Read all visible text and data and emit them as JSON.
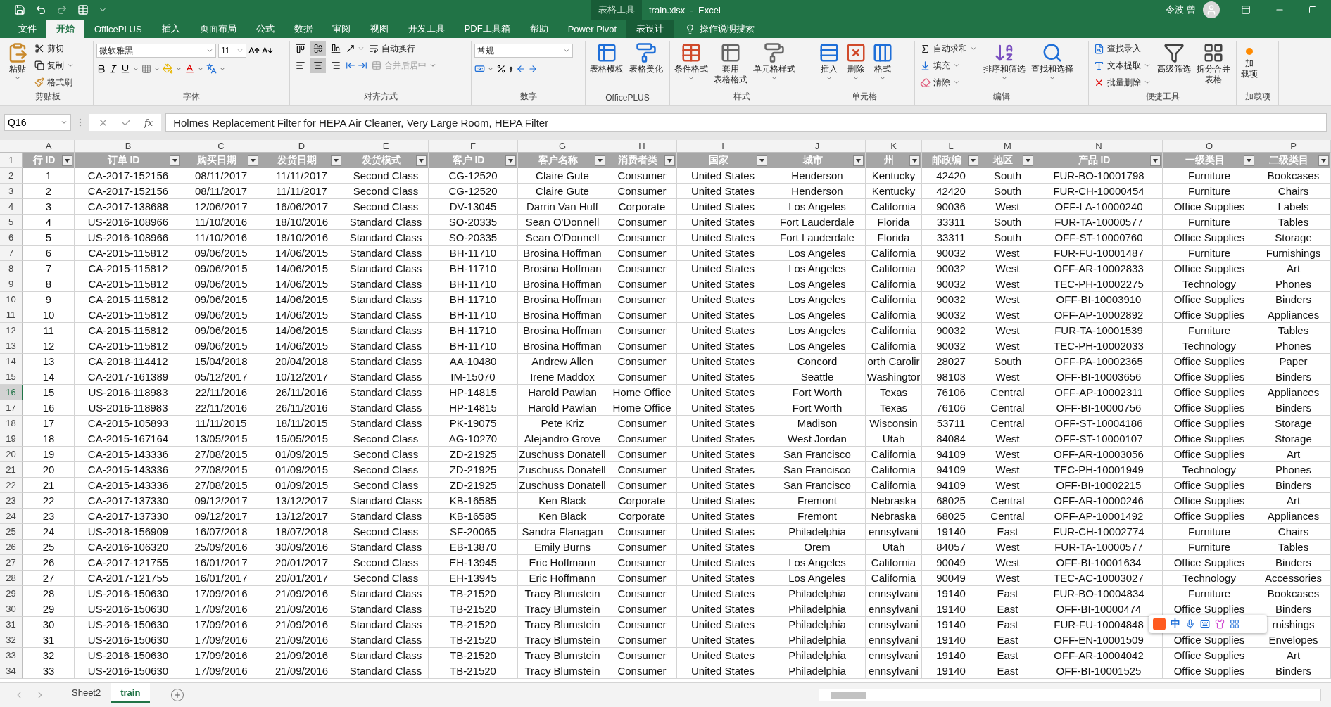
{
  "title_bar": {
    "context_label": "表格工具",
    "title": "train.xlsx  -  Excel",
    "user": "令波 曾"
  },
  "tabs": [
    {
      "label": "文件",
      "selected": false,
      "kind": "normal"
    },
    {
      "label": "开始",
      "selected": true,
      "kind": "normal"
    },
    {
      "label": "OfficePLUS",
      "selected": false,
      "kind": "normal"
    },
    {
      "label": "插入",
      "selected": false,
      "kind": "normal"
    },
    {
      "label": "页面布局",
      "selected": false,
      "kind": "normal"
    },
    {
      "label": "公式",
      "selected": false,
      "kind": "normal"
    },
    {
      "label": "数据",
      "selected": false,
      "kind": "normal"
    },
    {
      "label": "审阅",
      "selected": false,
      "kind": "normal"
    },
    {
      "label": "视图",
      "selected": false,
      "kind": "normal"
    },
    {
      "label": "开发工具",
      "selected": false,
      "kind": "normal"
    },
    {
      "label": "PDF工具箱",
      "selected": false,
      "kind": "normal"
    },
    {
      "label": "帮助",
      "selected": false,
      "kind": "normal"
    },
    {
      "label": "Power Pivot",
      "selected": false,
      "kind": "normal"
    },
    {
      "label": "表设计",
      "selected": false,
      "kind": "context"
    }
  ],
  "tell_me": "操作说明搜索",
  "ribbon": {
    "clipboard": {
      "label": "剪贴板",
      "paste": "粘贴",
      "cut": "剪切",
      "copy": "复制",
      "format_painter": "格式刷"
    },
    "font": {
      "label": "字体",
      "font_name": "微软雅黑",
      "font_size": "11"
    },
    "alignment": {
      "label": "对齐方式",
      "valign": [
        {
          "selected": false
        },
        {
          "selected": true
        },
        {
          "selected": false
        }
      ],
      "halign": [
        {
          "selected": false
        },
        {
          "selected": true
        },
        {
          "selected": false
        }
      ],
      "wrap_text": "自动换行",
      "merge_center": {
        "label": "合并后居中",
        "disabled": true
      }
    },
    "number": {
      "label": "数字",
      "format": "常规"
    },
    "officeplus": {
      "label": "OfficePLUS",
      "table_template": "表格模板",
      "table_beautify": "表格美化"
    },
    "styles": {
      "label": "样式",
      "conditional": "条件格式",
      "format_as_table": [
        "套用",
        "表格格式"
      ],
      "cell_styles": "单元格样式"
    },
    "cells": {
      "label": "单元格",
      "insert": "插入",
      "delete": "删除",
      "format": "格式"
    },
    "editing": {
      "label": "编辑",
      "autosum": "自动求和",
      "fill": "填充",
      "clear": "清除",
      "sort_filter": "排序和筛选",
      "find_select": "查找和选择"
    },
    "tools": {
      "label": "便捷工具",
      "find_entry": "查找录入",
      "text_extract": "文本提取",
      "batch_delete": "批量删除",
      "advanced_filter": "高级筛选",
      "split_merge": [
        "拆分合并",
        "表格"
      ]
    },
    "addins": {
      "label": "加载项",
      "button": [
        "加",
        "载项"
      ]
    }
  },
  "formula_bar": {
    "name_box": "Q16",
    "fx": "fx",
    "content": "Holmes Replacement Filter for HEPA Air Cleaner, Very Large Room, HEPA Filter"
  },
  "column_letters": [
    "A",
    "B",
    "C",
    "D",
    "E",
    "F",
    "G",
    "H",
    "I",
    "J",
    "K",
    "L",
    "M",
    "N",
    "O",
    "P"
  ],
  "header_row": {
    "row": "1",
    "cells": [
      "行 ID",
      "订单 ID",
      "购买日期",
      "发货日期",
      "发货模式",
      "客户 ID",
      "客户名称",
      "消费者类",
      "国家",
      "城市",
      "州",
      "邮政编",
      "地区",
      "产品 ID",
      "一级类目",
      "二级类目"
    ]
  },
  "rows": [
    {
      "row": "2",
      "selected": false,
      "cells": [
        "1",
        "CA-2017-152156",
        "08/11/2017",
        "11/11/2017",
        "Second Class",
        "CG-12520",
        "Claire Gute",
        "Consumer",
        "United States",
        "Henderson",
        "Kentucky",
        "42420",
        "South",
        "FUR-BO-10001798",
        "Furniture",
        "Bookcases"
      ]
    },
    {
      "row": "3",
      "selected": false,
      "cells": [
        "2",
        "CA-2017-152156",
        "08/11/2017",
        "11/11/2017",
        "Second Class",
        "CG-12520",
        "Claire Gute",
        "Consumer",
        "United States",
        "Henderson",
        "Kentucky",
        "42420",
        "South",
        "FUR-CH-10000454",
        "Furniture",
        "Chairs"
      ]
    },
    {
      "row": "4",
      "selected": false,
      "cells": [
        "3",
        "CA-2017-138688",
        "12/06/2017",
        "16/06/2017",
        "Second Class",
        "DV-13045",
        "Darrin Van Huff",
        "Corporate",
        "United States",
        "Los Angeles",
        "California",
        "90036",
        "West",
        "OFF-LA-10000240",
        "Office Supplies",
        "Labels"
      ]
    },
    {
      "row": "5",
      "selected": false,
      "cells": [
        "4",
        "US-2016-108966",
        "11/10/2016",
        "18/10/2016",
        "Standard Class",
        "SO-20335",
        "Sean O'Donnell",
        "Consumer",
        "United States",
        "Fort Lauderdale",
        "Florida",
        "33311",
        "South",
        "FUR-TA-10000577",
        "Furniture",
        "Tables"
      ]
    },
    {
      "row": "6",
      "selected": false,
      "cells": [
        "5",
        "US-2016-108966",
        "11/10/2016",
        "18/10/2016",
        "Standard Class",
        "SO-20335",
        "Sean O'Donnell",
        "Consumer",
        "United States",
        "Fort Lauderdale",
        "Florida",
        "33311",
        "South",
        "OFF-ST-10000760",
        "Office Supplies",
        "Storage"
      ]
    },
    {
      "row": "7",
      "selected": false,
      "cells": [
        "6",
        "CA-2015-115812",
        "09/06/2015",
        "14/06/2015",
        "Standard Class",
        "BH-11710",
        "Brosina Hoffman",
        "Consumer",
        "United States",
        "Los Angeles",
        "California",
        "90032",
        "West",
        "FUR-FU-10001487",
        "Furniture",
        "Furnishings"
      ]
    },
    {
      "row": "8",
      "selected": false,
      "cells": [
        "7",
        "CA-2015-115812",
        "09/06/2015",
        "14/06/2015",
        "Standard Class",
        "BH-11710",
        "Brosina Hoffman",
        "Consumer",
        "United States",
        "Los Angeles",
        "California",
        "90032",
        "West",
        "OFF-AR-10002833",
        "Office Supplies",
        "Art"
      ]
    },
    {
      "row": "9",
      "selected": false,
      "cells": [
        "8",
        "CA-2015-115812",
        "09/06/2015",
        "14/06/2015",
        "Standard Class",
        "BH-11710",
        "Brosina Hoffman",
        "Consumer",
        "United States",
        "Los Angeles",
        "California",
        "90032",
        "West",
        "TEC-PH-10002275",
        "Technology",
        "Phones"
      ]
    },
    {
      "row": "10",
      "selected": false,
      "cells": [
        "9",
        "CA-2015-115812",
        "09/06/2015",
        "14/06/2015",
        "Standard Class",
        "BH-11710",
        "Brosina Hoffman",
        "Consumer",
        "United States",
        "Los Angeles",
        "California",
        "90032",
        "West",
        "OFF-BI-10003910",
        "Office Supplies",
        "Binders"
      ]
    },
    {
      "row": "11",
      "selected": false,
      "cells": [
        "10",
        "CA-2015-115812",
        "09/06/2015",
        "14/06/2015",
        "Standard Class",
        "BH-11710",
        "Brosina Hoffman",
        "Consumer",
        "United States",
        "Los Angeles",
        "California",
        "90032",
        "West",
        "OFF-AP-10002892",
        "Office Supplies",
        "Appliances"
      ]
    },
    {
      "row": "12",
      "selected": false,
      "cells": [
        "11",
        "CA-2015-115812",
        "09/06/2015",
        "14/06/2015",
        "Standard Class",
        "BH-11710",
        "Brosina Hoffman",
        "Consumer",
        "United States",
        "Los Angeles",
        "California",
        "90032",
        "West",
        "FUR-TA-10001539",
        "Furniture",
        "Tables"
      ]
    },
    {
      "row": "13",
      "selected": false,
      "cells": [
        "12",
        "CA-2015-115812",
        "09/06/2015",
        "14/06/2015",
        "Standard Class",
        "BH-11710",
        "Brosina Hoffman",
        "Consumer",
        "United States",
        "Los Angeles",
        "California",
        "90032",
        "West",
        "TEC-PH-10002033",
        "Technology",
        "Phones"
      ]
    },
    {
      "row": "14",
      "selected": false,
      "cells": [
        "13",
        "CA-2018-114412",
        "15/04/2018",
        "20/04/2018",
        "Standard Class",
        "AA-10480",
        "Andrew Allen",
        "Consumer",
        "United States",
        "Concord",
        "orth Carolir",
        "28027",
        "South",
        "OFF-PA-10002365",
        "Office Supplies",
        "Paper"
      ]
    },
    {
      "row": "15",
      "selected": false,
      "cells": [
        "14",
        "CA-2017-161389",
        "05/12/2017",
        "10/12/2017",
        "Standard Class",
        "IM-15070",
        "Irene Maddox",
        "Consumer",
        "United States",
        "Seattle",
        "Washingtor",
        "98103",
        "West",
        "OFF-BI-10003656",
        "Office Supplies",
        "Binders"
      ]
    },
    {
      "row": "16",
      "selected": true,
      "cells": [
        "15",
        "US-2016-118983",
        "22/11/2016",
        "26/11/2016",
        "Standard Class",
        "HP-14815",
        "Harold Pawlan",
        "Home Office",
        "United States",
        "Fort Worth",
        "Texas",
        "76106",
        "Central",
        "OFF-AP-10002311",
        "Office Supplies",
        "Appliances"
      ]
    },
    {
      "row": "17",
      "selected": false,
      "cells": [
        "16",
        "US-2016-118983",
        "22/11/2016",
        "26/11/2016",
        "Standard Class",
        "HP-14815",
        "Harold Pawlan",
        "Home Office",
        "United States",
        "Fort Worth",
        "Texas",
        "76106",
        "Central",
        "OFF-BI-10000756",
        "Office Supplies",
        "Binders"
      ]
    },
    {
      "row": "18",
      "selected": false,
      "cells": [
        "17",
        "CA-2015-105893",
        "11/11/2015",
        "18/11/2015",
        "Standard Class",
        "PK-19075",
        "Pete Kriz",
        "Consumer",
        "United States",
        "Madison",
        "Wisconsin",
        "53711",
        "Central",
        "OFF-ST-10004186",
        "Office Supplies",
        "Storage"
      ]
    },
    {
      "row": "19",
      "selected": false,
      "cells": [
        "18",
        "CA-2015-167164",
        "13/05/2015",
        "15/05/2015",
        "Second Class",
        "AG-10270",
        "Alejandro Grove",
        "Consumer",
        "United States",
        "West Jordan",
        "Utah",
        "84084",
        "West",
        "OFF-ST-10000107",
        "Office Supplies",
        "Storage"
      ]
    },
    {
      "row": "20",
      "selected": false,
      "cells": [
        "19",
        "CA-2015-143336",
        "27/08/2015",
        "01/09/2015",
        "Second Class",
        "ZD-21925",
        "Zuschuss Donatell",
        "Consumer",
        "United States",
        "San Francisco",
        "California",
        "94109",
        "West",
        "OFF-AR-10003056",
        "Office Supplies",
        "Art"
      ]
    },
    {
      "row": "21",
      "selected": false,
      "cells": [
        "20",
        "CA-2015-143336",
        "27/08/2015",
        "01/09/2015",
        "Second Class",
        "ZD-21925",
        "Zuschuss Donatell",
        "Consumer",
        "United States",
        "San Francisco",
        "California",
        "94109",
        "West",
        "TEC-PH-10001949",
        "Technology",
        "Phones"
      ]
    },
    {
      "row": "22",
      "selected": false,
      "cells": [
        "21",
        "CA-2015-143336",
        "27/08/2015",
        "01/09/2015",
        "Second Class",
        "ZD-21925",
        "Zuschuss Donatell",
        "Consumer",
        "United States",
        "San Francisco",
        "California",
        "94109",
        "West",
        "OFF-BI-10002215",
        "Office Supplies",
        "Binders"
      ]
    },
    {
      "row": "23",
      "selected": false,
      "cells": [
        "22",
        "CA-2017-137330",
        "09/12/2017",
        "13/12/2017",
        "Standard Class",
        "KB-16585",
        "Ken Black",
        "Corporate",
        "United States",
        "Fremont",
        "Nebraska",
        "68025",
        "Central",
        "OFF-AR-10000246",
        "Office Supplies",
        "Art"
      ]
    },
    {
      "row": "24",
      "selected": false,
      "cells": [
        "23",
        "CA-2017-137330",
        "09/12/2017",
        "13/12/2017",
        "Standard Class",
        "KB-16585",
        "Ken Black",
        "Corporate",
        "United States",
        "Fremont",
        "Nebraska",
        "68025",
        "Central",
        "OFF-AP-10001492",
        "Office Supplies",
        "Appliances"
      ]
    },
    {
      "row": "25",
      "selected": false,
      "cells": [
        "24",
        "US-2018-156909",
        "16/07/2018",
        "18/07/2018",
        "Second Class",
        "SF-20065",
        "Sandra Flanagan",
        "Consumer",
        "United States",
        "Philadelphia",
        "ennsylvani",
        "19140",
        "East",
        "FUR-CH-10002774",
        "Furniture",
        "Chairs"
      ]
    },
    {
      "row": "26",
      "selected": false,
      "cells": [
        "25",
        "CA-2016-106320",
        "25/09/2016",
        "30/09/2016",
        "Standard Class",
        "EB-13870",
        "Emily Burns",
        "Consumer",
        "United States",
        "Orem",
        "Utah",
        "84057",
        "West",
        "FUR-TA-10000577",
        "Furniture",
        "Tables"
      ]
    },
    {
      "row": "27",
      "selected": false,
      "cells": [
        "26",
        "CA-2017-121755",
        "16/01/2017",
        "20/01/2017",
        "Second Class",
        "EH-13945",
        "Eric Hoffmann",
        "Consumer",
        "United States",
        "Los Angeles",
        "California",
        "90049",
        "West",
        "OFF-BI-10001634",
        "Office Supplies",
        "Binders"
      ]
    },
    {
      "row": "28",
      "selected": false,
      "cells": [
        "27",
        "CA-2017-121755",
        "16/01/2017",
        "20/01/2017",
        "Second Class",
        "EH-13945",
        "Eric Hoffmann",
        "Consumer",
        "United States",
        "Los Angeles",
        "California",
        "90049",
        "West",
        "TEC-AC-10003027",
        "Technology",
        "Accessories"
      ]
    },
    {
      "row": "29",
      "selected": false,
      "cells": [
        "28",
        "US-2016-150630",
        "17/09/2016",
        "21/09/2016",
        "Standard Class",
        "TB-21520",
        "Tracy Blumstein",
        "Consumer",
        "United States",
        "Philadelphia",
        "ennsylvani",
        "19140",
        "East",
        "FUR-BO-10004834",
        "Furniture",
        "Bookcases"
      ]
    },
    {
      "row": "30",
      "selected": false,
      "cells": [
        "29",
        "US-2016-150630",
        "17/09/2016",
        "21/09/2016",
        "Standard Class",
        "TB-21520",
        "Tracy Blumstein",
        "Consumer",
        "United States",
        "Philadelphia",
        "ennsylvani",
        "19140",
        "East",
        "OFF-BI-10000474",
        "Office Supplies",
        "Binders"
      ]
    },
    {
      "row": "31",
      "selected": false,
      "cells": [
        "30",
        "US-2016-150630",
        "17/09/2016",
        "21/09/2016",
        "Standard Class",
        "TB-21520",
        "Tracy Blumstein",
        "Consumer",
        "United States",
        "Philadelphia",
        "ennsylvani",
        "19140",
        "East",
        "FUR-FU-10004848",
        null,
        "rnishings"
      ]
    },
    {
      "row": "32",
      "selected": false,
      "cells": [
        "31",
        "US-2016-150630",
        "17/09/2016",
        "21/09/2016",
        "Standard Class",
        "TB-21520",
        "Tracy Blumstein",
        "Consumer",
        "United States",
        "Philadelphia",
        "ennsylvani",
        "19140",
        "East",
        "OFF-EN-10001509",
        "Office Supplies",
        "Envelopes"
      ]
    },
    {
      "row": "33",
      "selected": false,
      "cells": [
        "32",
        "US-2016-150630",
        "17/09/2016",
        "21/09/2016",
        "Standard Class",
        "TB-21520",
        "Tracy Blumstein",
        "Consumer",
        "United States",
        "Philadelphia",
        "ennsylvani",
        "19140",
        "East",
        "OFF-AR-10004042",
        "Office Supplies",
        "Art"
      ]
    },
    {
      "row": "34",
      "selected": false,
      "cells": [
        "33",
        "US-2016-150630",
        "17/09/2016",
        "21/09/2016",
        "Standard Class",
        "TB-21520",
        "Tracy Blumstein",
        "Consumer",
        "United States",
        "Philadelphia",
        "ennsylvani",
        "19140",
        "East",
        "OFF-BI-10001525",
        "Office Supplies",
        "Binders"
      ]
    }
  ],
  "ime_toolbar": {
    "mode": "中"
  },
  "sheets": [
    {
      "label": "Sheet2",
      "selected": false
    },
    {
      "label": "train",
      "selected": true
    }
  ]
}
